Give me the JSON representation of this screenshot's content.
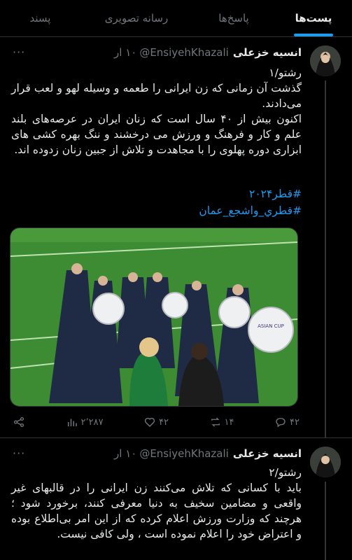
{
  "tabs": [
    {
      "label": "پست‌ها",
      "active": true
    },
    {
      "label": "پاسخ‌ها",
      "active": false
    },
    {
      "label": "رسانه تصویری",
      "active": false
    },
    {
      "label": "پسند",
      "active": false
    }
  ],
  "colors": {
    "accent": "#1d9bf0",
    "background": "#000000",
    "muted": "#71767b"
  },
  "tweets": [
    {
      "name": "انسیه خزعلی",
      "handle": "@EnsiyehKhazali",
      "time": "۱۰ ار",
      "lines": [
        "رشتو/۱",
        "گذشت آن زمانی که زن ایرانی را طعمه و وسیله لهو و لعب قرار می‌دادند.",
        "اکنون بیش از ۴۰ سال است که زنان ایران در عرصه‌های بلند علم و کار و فرهنگ و ورزش می درخشند و ننگ بهره کشی های ابزاری دوره پهلوی را با مجاهدت و تلاش از جبین زنان زدوده اند."
      ],
      "hashtags": [
        "#قطر۲۰۲۴",
        "#قطري_واشجع_عمان"
      ],
      "media": {
        "banner": "ASIAN CUP"
      },
      "actions": {
        "views": "۲٬۲۸۷",
        "likes": "۴۲",
        "retweets": "۱۴",
        "replies": "۴۲"
      }
    },
    {
      "name": "انسیه خزعلی",
      "handle": "@EnsiyehKhazali",
      "time": "۱۰ ار",
      "lines": [
        "رشتو/۲",
        "باید با کسانی که تلاش می‌کنند زن ایرانی را در قالبهای غیر واقعی و مضامین سخیف به دنیا معرفی کنند، برخورد شود ؛ هرچند که وزارت ورزش اعلام کرده که از این امر بی‌اطلاع بوده و اعتراض خود را اعلام نموده است ، ولی کافی نیست."
      ]
    }
  ]
}
